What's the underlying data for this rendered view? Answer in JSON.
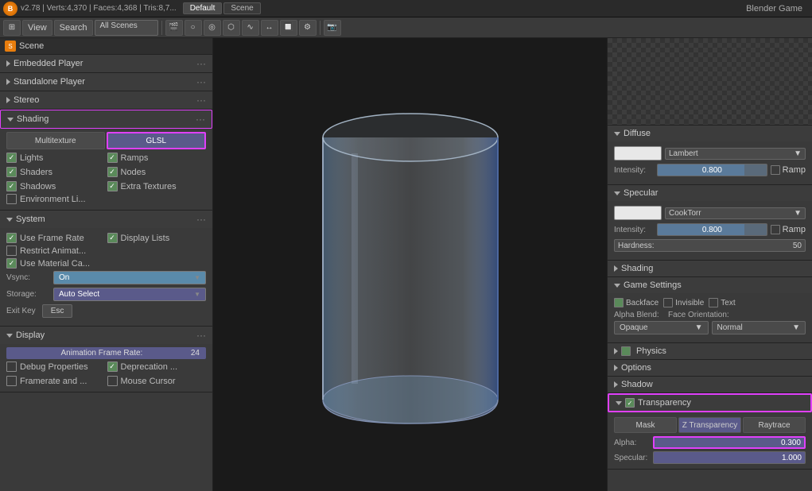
{
  "topbar": {
    "logo": "B",
    "version": "v2.78 | Verts:4,370 | Faces:4,368 | Tris:8,7...",
    "tab1": "Default",
    "tab2": "Scene",
    "game_title": "Blender Game"
  },
  "toolbar": {
    "view_label": "View",
    "search_label": "Search",
    "scenes_dropdown": "All Scenes"
  },
  "left_panel": {
    "scene_label": "Scene",
    "embedded_player": "Embedded Player",
    "standalone_player": "Standalone Player",
    "stereo": "Stereo",
    "shading_label": "Shading",
    "multitexture_btn": "Multitexture",
    "glsl_btn": "GLSL",
    "lights_label": "Lights",
    "ramps_label": "Ramps",
    "shaders_label": "Shaders",
    "nodes_label": "Nodes",
    "shadows_label": "Shadows",
    "extra_textures_label": "Extra Textures",
    "env_lights_label": "Environment Li...",
    "system_label": "System",
    "use_frame_rate": "Use Frame Rate",
    "display_lists": "Display Lists",
    "restrict_anim": "Restrict Animat...",
    "use_material": "Use Material Ca...",
    "vsync_label": "Vsync:",
    "vsync_value": "On",
    "storage_label": "Storage:",
    "storage_value": "Auto Select",
    "exit_key_label": "Exit Key",
    "esc_label": "Esc",
    "display_label": "Display",
    "anim_frame_rate": "Animation Frame Rate:",
    "anim_frame_value": "24",
    "debug_properties": "Debug Properties",
    "deprecation": "Deprecation ...",
    "framerate_and": "Framerate and ...",
    "mouse_cursor": "Mouse Cursor"
  },
  "right_panel": {
    "diffuse_label": "Diffuse",
    "diffuse_shader": "Lambert",
    "diffuse_intensity": "Intensity:",
    "diffuse_intensity_value": "0.800",
    "diffuse_ramp": "Ramp",
    "specular_label": "Specular",
    "specular_shader": "CookTorr",
    "specular_intensity": "Intensity:",
    "specular_intensity_value": "0.800",
    "specular_ramp": "Ramp",
    "hardness_label": "Hardness:",
    "hardness_value": "50",
    "shading_label": "Shading",
    "game_settings_label": "Game Settings",
    "backface_label": "Backface",
    "invisible_label": "Invisible",
    "text_label": "Text",
    "alpha_blend_label": "Alpha Blend:",
    "face_orientation_label": "Face Orientation:",
    "opaque_label": "Opaque",
    "normal_label": "Normal",
    "physics_label": "Physics",
    "options_label": "Options",
    "shadow_label": "Shadow",
    "transparency_label": "Transparency",
    "mask_btn": "Mask",
    "z_transparency_btn": "Z Transparency",
    "raytrace_btn": "Raytrace",
    "alpha_label": "Alpha:",
    "alpha_value": "0.300",
    "specular2_label": "Specular:",
    "specular2_value": "1.000"
  }
}
